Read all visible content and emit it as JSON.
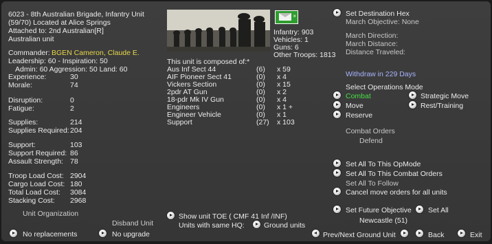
{
  "header": {
    "line1": "6023 - 8th Australian Brigade, Infantry Unit",
    "line2": "(59/70) Located at Alice Springs",
    "line3": "Attached to:  2nd Australian[R]",
    "line4": "Australian unit"
  },
  "commander": {
    "label": "Commander:",
    "name": "BGEN Cameron, Claude E."
  },
  "leadership": "Leadership: 60 - Inspiration: 50",
  "admin": "Admin: 60  Aggression: 50 Land: 60",
  "stats1": [
    {
      "label": "Experience:",
      "value": "30"
    },
    {
      "label": "Morale:",
      "value": "74"
    }
  ],
  "stats2": [
    {
      "label": "Disruption:",
      "value": "0"
    },
    {
      "label": "Fatigue:",
      "value": "2"
    }
  ],
  "stats3": [
    {
      "label": "Supplies:",
      "value": "214"
    },
    {
      "label": "Supplies Required:",
      "value": "204"
    }
  ],
  "stats4": [
    {
      "label": "Support:",
      "value": "103"
    },
    {
      "label": "Support Required:",
      "value": "86"
    },
    {
      "label": "Assault Strength:",
      "value": "78"
    }
  ],
  "stats5": [
    {
      "label": "Troop Load Cost:",
      "value": "2904"
    },
    {
      "label": "Cargo Load Cost:",
      "value": "180"
    },
    {
      "label": "Total Load Cost:",
      "value": "3084"
    },
    {
      "label": "Stacking Cost:",
      "value": "2968"
    }
  ],
  "bottom_left": {
    "unit_org": "Unit Organization",
    "disband": "Disband Unit",
    "no_replacements": "No replacements",
    "no_upgrade": "No upgrade"
  },
  "counts": {
    "infantry": "Infantry: 903",
    "vehicles": "Vehicles: 1",
    "guns": "Guns: 6",
    "other": "Other Troops: 1813"
  },
  "composition": {
    "title": "This unit is composed of:*",
    "rows": [
      {
        "name": "Aus Inf Sect 44",
        "dis": "(6)",
        "qty": "x 59"
      },
      {
        "name": "AIF Pioneer Sect 41",
        "dis": "(0)",
        "qty": "x 4"
      },
      {
        "name": "Vickers Section",
        "dis": "(0)",
        "qty": "x 15"
      },
      {
        "name": "2pdr AT Gun",
        "dis": "(0)",
        "qty": "x 2"
      },
      {
        "name": "18-pdr Mk IV Gun",
        "dis": "(0)",
        "qty": "x 4"
      },
      {
        "name": "Engineers",
        "dis": "(0)",
        "qty": "x 1 +"
      },
      {
        "name": "Engineer Vehicle",
        "dis": "(0)",
        "qty": "x 1"
      },
      {
        "name": "Support",
        "dis": "(27)",
        "qty": "x 103"
      }
    ]
  },
  "toe": {
    "show_toe": "Show unit TOE ( CMF 41 Inf /INF)",
    "same_hq": "Units with same HQ:",
    "ground_units": "Ground units"
  },
  "right": {
    "set_destination": "Set Destination Hex",
    "march_objective": "March Objective: None",
    "march_direction": "March Direction:",
    "march_distance": "March Distance:",
    "distance_traveled": "Distance Traveled:",
    "withdraw": "Withdraw in 229 Days",
    "select_ops": "Select Operations Mode",
    "combat": "Combat",
    "move": "Move",
    "reserve": "Reserve",
    "strategic_move": "Strategic Move",
    "rest_training": "Rest/Training",
    "combat_orders": "Combat Orders",
    "defend": "Defend",
    "set_all_opmode": "Set All To This OpMode",
    "set_all_combat": "Set All To This Combat Orders",
    "set_all_follow": "Set All To Follow",
    "cancel_move": "Cancel move orders for all units",
    "set_future": "Set Future Objective",
    "set_all": "Set All",
    "newcastle": "Newcastle (51)"
  },
  "nav": {
    "prev_next": "Prev/Next Ground Unit",
    "back": "Back",
    "exit": "Exit"
  },
  "colors": {
    "commander_name": "#e8d84a",
    "combat_selected": "#45e045",
    "withdraw": "#a8b4ff"
  }
}
